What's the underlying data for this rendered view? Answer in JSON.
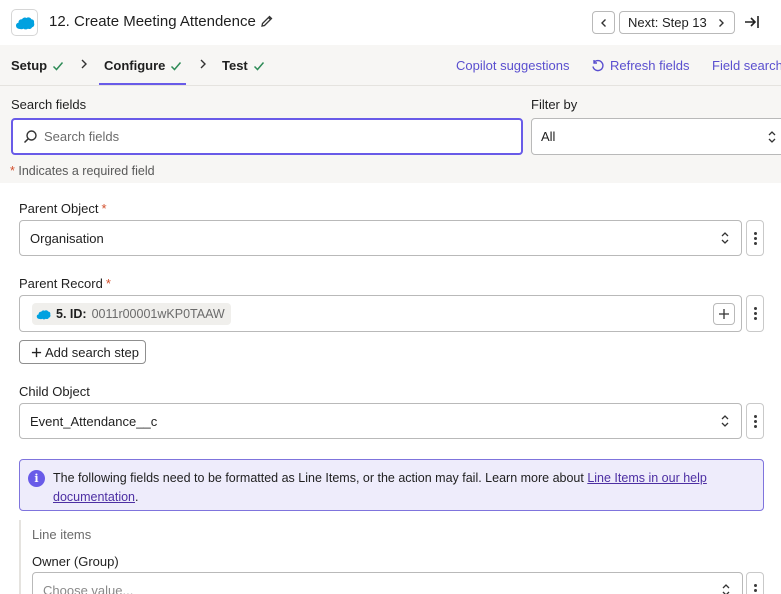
{
  "header": {
    "step_title": "12. Create Meeting Attendence",
    "next_label": "Next: Step 13"
  },
  "tabs": [
    {
      "label": "Setup"
    },
    {
      "label": "Configure"
    },
    {
      "label": "Test"
    }
  ],
  "toolbar": {
    "copilot": "Copilot suggestions",
    "refresh": "Refresh fields",
    "field_search": "Field search"
  },
  "search": {
    "label": "Search fields",
    "placeholder": "Search fields",
    "filter_label": "Filter by",
    "filter_value": "All",
    "required_note": "Indicates a required field",
    "required_star": "*"
  },
  "fields": {
    "parent_object": {
      "label": "Parent Object",
      "star": "*",
      "value": "Organisation"
    },
    "parent_record": {
      "label": "Parent Record",
      "star": "*",
      "pill_key": "5. ID:",
      "pill_value": "0011r00001wKP0TAAW"
    },
    "add_search_step": "Add search step",
    "child_object": {
      "label": "Child Object",
      "value": "Event_Attendance__c"
    }
  },
  "info": {
    "text": "The following fields need to be formatted as Line Items, or the action may fail. Learn more about ",
    "link": "Line Items in our help documentation",
    "suffix": "."
  },
  "line_items": {
    "heading": "Line items",
    "owner_label": "Owner (Group)",
    "owner_placeholder": "Choose value..."
  },
  "colors": {
    "accent": "#695be8",
    "check": "#2e8b57",
    "link": "#5a4fcf",
    "required": "#d24e2b"
  },
  "icons": [
    "salesforce-logo-icon",
    "pencil-icon",
    "chevron-left-icon",
    "chevron-right-icon",
    "exit-arrow-icon",
    "check-icon",
    "refresh-icon",
    "search-icon",
    "updown-chevron-icon",
    "kebab-icon",
    "plus-icon",
    "info-icon"
  ]
}
